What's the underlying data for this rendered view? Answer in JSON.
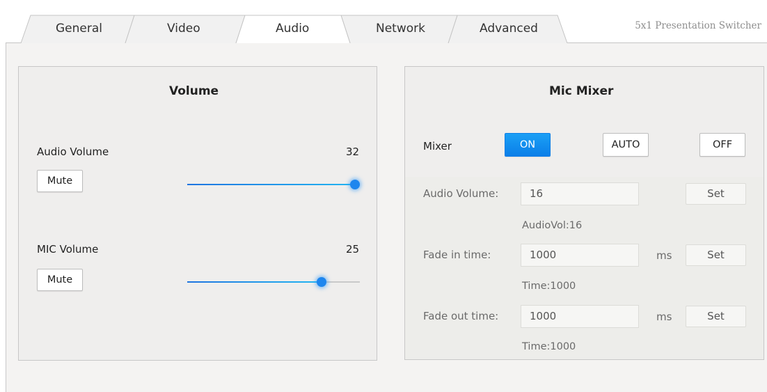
{
  "tabs": [
    {
      "label": "General"
    },
    {
      "label": "Video"
    },
    {
      "label": "Audio"
    },
    {
      "label": "Network"
    },
    {
      "label": "Advanced"
    }
  ],
  "active_tab": "Audio",
  "app_title": "5x1 Presentation Switcher",
  "volume_panel": {
    "title": "Volume",
    "audio": {
      "label": "Audio Volume",
      "value": "32",
      "mute_label": "Mute",
      "level_fraction": 1.0
    },
    "mic": {
      "label": "MIC Volume",
      "value": "25",
      "mute_label": "Mute",
      "level_fraction": 0.78
    }
  },
  "mic_mixer": {
    "title": "Mic Mixer",
    "mixer_label": "Mixer",
    "modes": {
      "on": "ON",
      "auto": "AUTO",
      "off": "OFF"
    },
    "active_mode": "ON",
    "audio_volume": {
      "label": "Audio Volume:",
      "value": "16",
      "set_label": "Set",
      "status": "AudioVol:16"
    },
    "fade_in": {
      "label": "Fade in time:",
      "value": "1000",
      "unit": "ms",
      "set_label": "Set",
      "status": "Time:1000"
    },
    "fade_out": {
      "label": "Fade out time:",
      "value": "1000",
      "unit": "ms",
      "set_label": "Set",
      "status": "Time:1000"
    }
  },
  "colors": {
    "accent": "#1a8ef0",
    "panel_bg": "#efeeed",
    "page_bg": "#f4f3f2"
  }
}
